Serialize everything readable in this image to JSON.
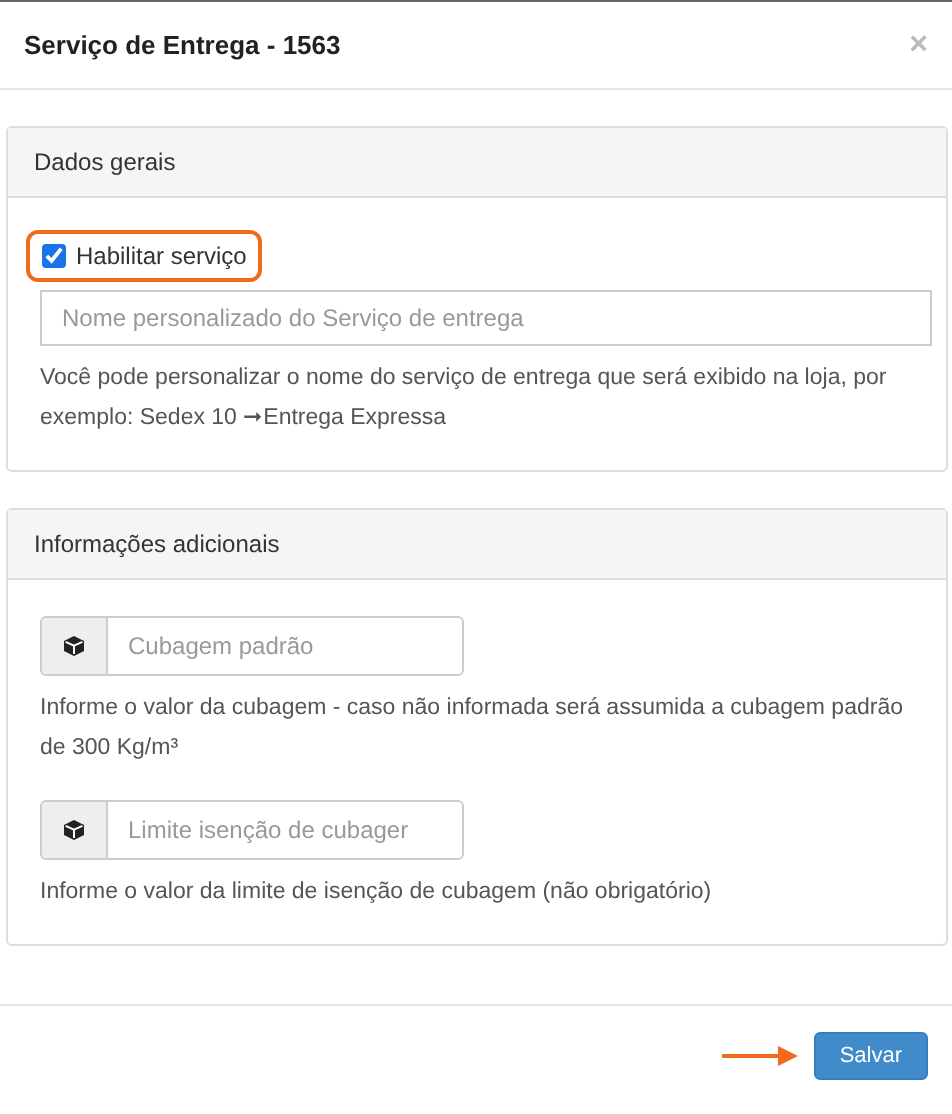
{
  "dialog": {
    "title": "Serviço de Entrega - 1563",
    "close": "×"
  },
  "panels": [
    {
      "title": "Dados gerais",
      "checkbox": {
        "label": "Habilitar serviço",
        "checked": true,
        "highlighted": true
      },
      "field": {
        "placeholder": "Nome personalizado do Serviço de entrega"
      },
      "help": "Você pode personalizar o nome do serviço de entrega que será exibido na loja, por exemplo: Sedex 10 ➞Entrega Expressa"
    },
    {
      "title": "Informações adicionais",
      "inputs": [
        {
          "placeholder": "Cubagem padrão",
          "help": "Informe o valor da cubagem - caso não informada será assumida a cubagem padrão de 300 Kg/m³"
        },
        {
          "placeholder": "Limite isenção de cubager",
          "help": "Informe o valor da limite de isenção de cubagem (não obrigatório)"
        }
      ]
    }
  ],
  "footer": {
    "button": "Salvar",
    "arrow_annotation": true
  }
}
